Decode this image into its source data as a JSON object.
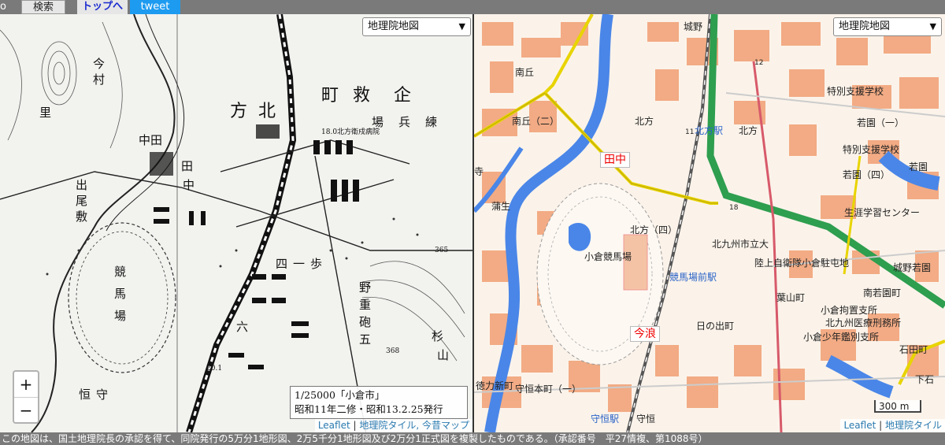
{
  "toolbar": {
    "mode_label": "o",
    "search_label": "検索",
    "top_label": "トップへ",
    "tweet_label": "tweet"
  },
  "left_map": {
    "layer_select": "地理院地図",
    "zoom_in": "+",
    "zoom_out": "−",
    "info_line1": "1/25000「小倉市」",
    "info_line2": "昭和11年二修・昭和13.2.25発行",
    "attrib_leaflet": "Leaflet",
    "attrib_sep": " | ",
    "attrib_tiles": "地理院タイル, 今昔マップ",
    "labels": {
      "machi_kyu": "町",
      "kyu": "救",
      "kuwadate": "企",
      "kata": "方",
      "kita": "北",
      "ba": "場",
      "hei": "兵",
      "ren": "練",
      "nakada": "中田",
      "ta": "田",
      "naka": "中",
      "de": "出",
      "o": "尾",
      "shiki": "敷",
      "ima": "今",
      "mura": "村",
      "sato": "里",
      "keiba1": "競",
      "keiba2": "馬",
      "keiba3": "場",
      "shi": "四",
      "ichi": "一",
      "ho": "歩",
      "ya": "野",
      "juu": "重",
      "ho2": "砲",
      "go": "五",
      "roku": "六",
      "sugi": "杉",
      "yama": "山",
      "tsune": "恒",
      "mamoru": "守",
      "elev1": "18.0",
      "elev2": "365",
      "elev3": "368",
      "elev4": "20.1",
      "hosp": "北方衛戍病院"
    }
  },
  "right_map": {
    "layer_select": "地理院地図",
    "red_label_tanaka": "田中",
    "red_label_imanami": "今浪",
    "scale": "300 m",
    "attrib_leaflet": "Leaflet",
    "attrib_sep": " | ",
    "attrib_tiles": "地理院タイル",
    "labels": {
      "minamigaoka": "南丘",
      "minamigaoka2": "南丘（二）",
      "kitakata": "北方",
      "kitakata_sta": "北方駅",
      "kitakata2": "北方",
      "kitakata4": "北方（四）",
      "joyano": "城野",
      "tokubetsu1": "特別支援学校",
      "tokubetsu2": "特別支援学校",
      "wakazono1": "若園（一）",
      "wakazono4": "若園（四）",
      "wakazono_edge": "若園",
      "shogai": "生涯学習センター",
      "kokura_keiba": "小倉競馬場",
      "keibajo_mae": "競馬場前駅",
      "kitakyu_ritsu": "北九州市立大",
      "jieitai": "陸上自衛隊小倉駐屯地",
      "hayama": "葉山町",
      "hinode": "日の出町",
      "kokura_kochi": "小倉拘置支所",
      "iryo": "北九州医療刑務所",
      "shonen": "小倉少年鑑別支所",
      "ishida": "石田町",
      "shimoishida": "下石",
      "tokuriki": "徳力新町",
      "morotsune_hon": "守恒本町（一）",
      "morotsune_sta": "守恒駅",
      "morotsune": "守恒",
      "kabuto": "蒲生",
      "minami_wakazono": "南若園町",
      "higashi_wakazono": "城野若園",
      "tera": "寺",
      "ken_num": "18",
      "ken_num2": "12",
      "ken_num3": "11"
    }
  },
  "notice": "この地図は、国土地理院長の承認を得て、同院発行の5万分1地形図、2万5千分1地形図及び2万分1正式図を複製したものである。（承認番号　平27情複、第1088号）"
}
